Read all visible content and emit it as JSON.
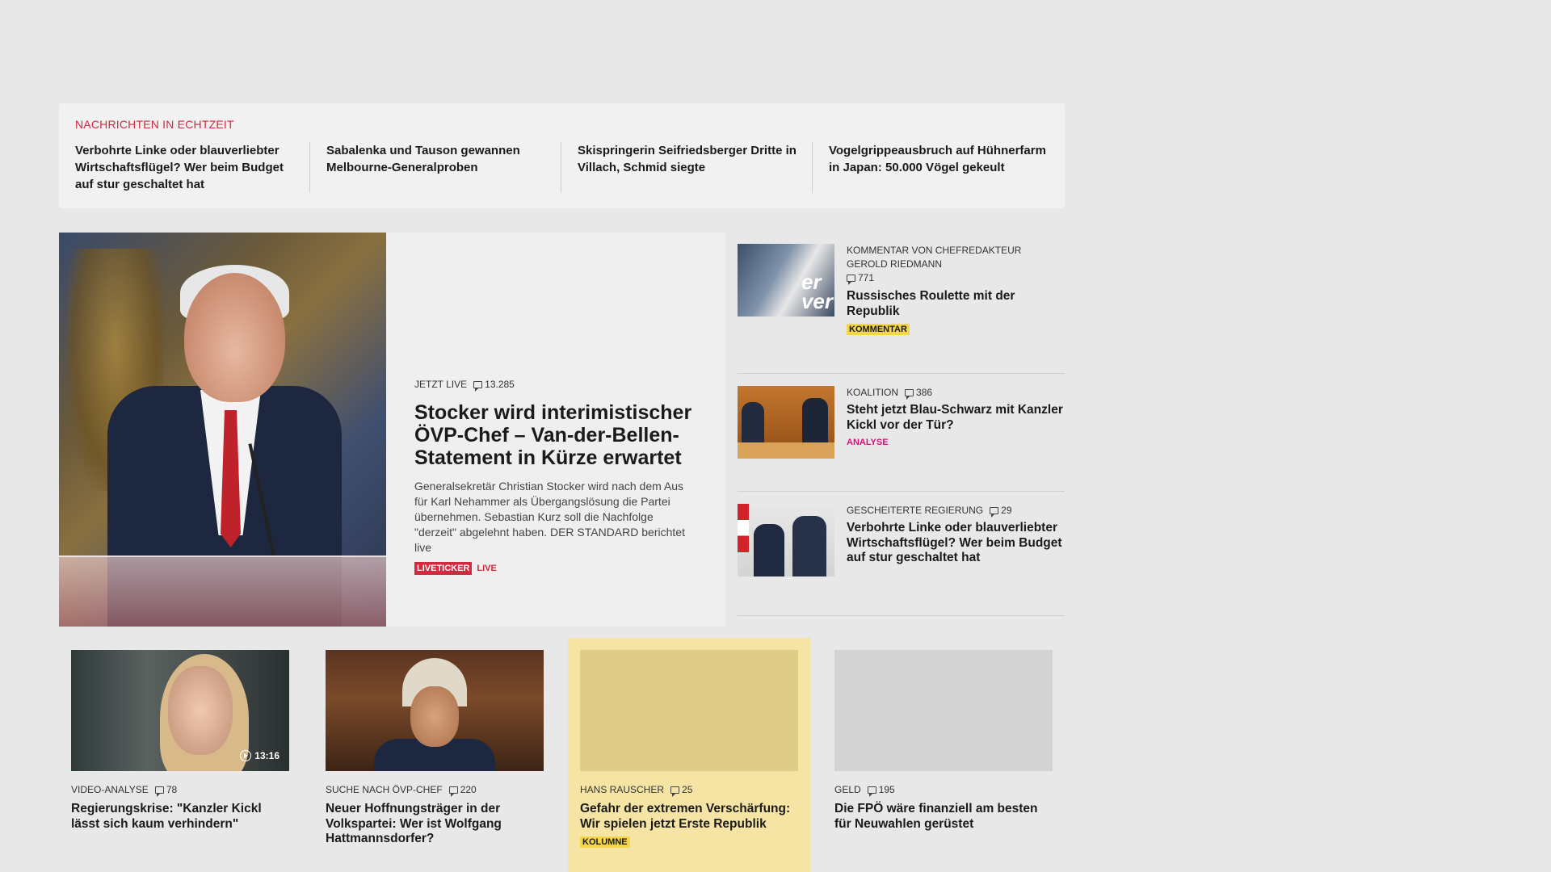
{
  "ticker": {
    "title": "NACHRICHTEN IN ECHTZEIT",
    "items": [
      "Verbohrte Linke oder blauverliebter Wirtschaftsflügel? Wer beim Budget auf stur geschaltet hat",
      "Sabalenka und Tauson gewannen Melbourne-Generalproben",
      "Skispringerin Seifriedsberger Dritte in Villach, Schmid siegte",
      "Vogelgrippeausbruch auf Hühnerfarm in Japan: 50.000 Vögel gekeult"
    ]
  },
  "hero": {
    "kicker": "JETZT LIVE",
    "comments": "13.285",
    "title": "Stocker wird interimistischer ÖVP-Chef – Van-der-Bellen-Statement in Kürze erwartet",
    "lead": "Generalsekretär Christian Stocker wird nach dem Aus für Karl Nehammer als Übergangslösung die Partei übernehmen. Sebastian Kurz soll die Nachfolge \"derzeit\" abgelehnt haben. DER STANDARD berichtet live",
    "badge": "LIVETICKER",
    "live_label": "LIVE"
  },
  "side": [
    {
      "kicker": "KOMMENTAR VON CHEFREDAKTEUR GEROLD RIEDMANN",
      "comments": "771",
      "title": "Russisches Roulette mit der Republik",
      "tag": "KOMMENTAR",
      "thumb_text": "er\nver"
    },
    {
      "kicker": "KOALITION",
      "comments": "386",
      "title": "Steht jetzt Blau-Schwarz mit Kanzler Kickl vor der Tür?",
      "tag": "ANALYSE"
    },
    {
      "kicker": "GESCHEITERTE REGIERUNG",
      "comments": "29",
      "title": "Verbohrte Linke oder blauverliebter Wirtschaftsflügel? Wer beim Budget auf stur geschaltet hat"
    }
  ],
  "bottom": [
    {
      "kicker": "VIDEO-ANALYSE",
      "comments": "78",
      "title": "Regierungskrise: \"Kanzler Kickl lässt sich kaum verhindern\"",
      "video_duration": "13:16"
    },
    {
      "kicker": "SUCHE NACH ÖVP-CHEF",
      "comments": "220",
      "title": "Neuer Hoffnungsträger in der Volkspartei: Wer ist Wolfgang Hattmannsdorfer?"
    },
    {
      "kicker": "HANS RAUSCHER",
      "comments": "25",
      "title": "Gefahr der extremen Verschärfung: Wir spielen jetzt Erste Republik",
      "tag": "KOLUMNE"
    },
    {
      "kicker": "GELD",
      "comments": "195",
      "title": "Die FPÖ wäre finanziell am besten für Neuwahlen gerüstet"
    }
  ],
  "colors": {
    "accent_red": "#d5273d",
    "analyse_pink": "#d0137a",
    "kommentar_yellow": "#f5d64a",
    "kolumne_bg": "#f6e4a4"
  }
}
